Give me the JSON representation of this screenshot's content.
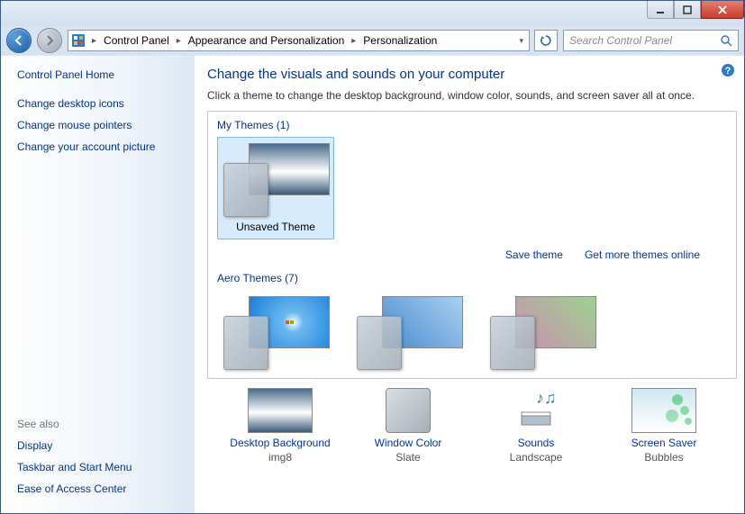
{
  "breadcrumb": {
    "items": [
      "Control Panel",
      "Appearance and Personalization",
      "Personalization"
    ]
  },
  "search": {
    "placeholder": "Search Control Panel"
  },
  "sidebar": {
    "home": "Control Panel Home",
    "links": [
      "Change desktop icons",
      "Change mouse pointers",
      "Change your account picture"
    ],
    "see_also_label": "See also",
    "see_also": [
      "Display",
      "Taskbar and Start Menu",
      "Ease of Access Center"
    ]
  },
  "main": {
    "heading": "Change the visuals and sounds on your computer",
    "subtext": "Click a theme to change the desktop background, window color, sounds, and screen saver all at once.",
    "my_themes_label": "My Themes (1)",
    "unsaved_theme": "Unsaved Theme",
    "save_theme": "Save theme",
    "get_more": "Get more themes online",
    "aero_label": "Aero Themes (7)"
  },
  "settings": {
    "desktop_bg": {
      "name": "Desktop Background",
      "value": "img8"
    },
    "window_color": {
      "name": "Window Color",
      "value": "Slate"
    },
    "sounds": {
      "name": "Sounds",
      "value": "Landscape"
    },
    "screen_saver": {
      "name": "Screen Saver",
      "value": "Bubbles"
    }
  }
}
